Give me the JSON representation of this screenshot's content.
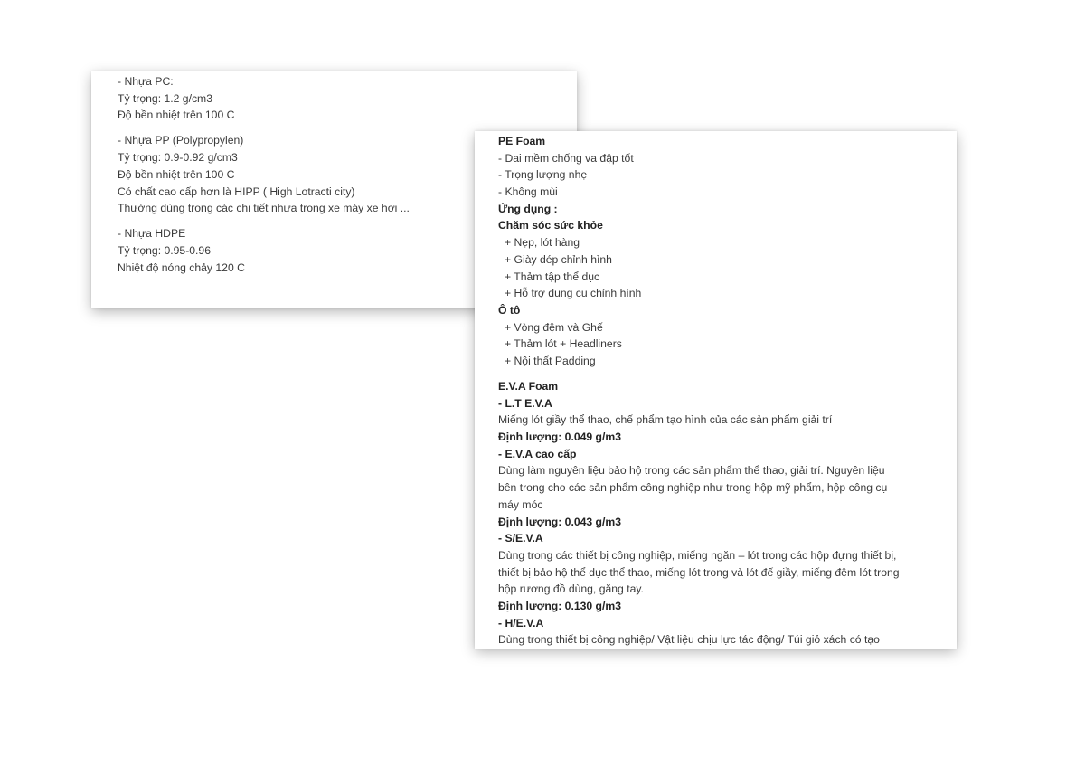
{
  "card_plastics": {
    "pc": {
      "title": "- Nhựa PC:",
      "lines": [
        "Tỷ trọng: 1.2 g/cm3",
        "Độ bền nhiệt trên 100 C"
      ]
    },
    "pp": {
      "title": "- Nhựa PP (Polypropylen)",
      "lines": [
        "Tỷ trọng: 0.9-0.92 g/cm3",
        "Độ bền nhiệt trên 100 C",
        "Có chất cao cấp hơn là HIPP ( High Lotracti city)",
        "Thường dùng trong các chi tiết nhựa trong xe máy xe hơi ..."
      ]
    },
    "hdpe": {
      "title": "- Nhựa HDPE",
      "lines": [
        "Tỷ trọng: 0.95-0.96",
        "Nhiệt độ nóng chảy 120 C"
      ]
    }
  },
  "card_foam": {
    "pe": {
      "title": "PE Foam",
      "features": [
        "- Dai mềm chống va đập tốt",
        "- Trọng lượng nhẹ",
        "- Không mùi"
      ],
      "applications_label": "Ứng dụng :",
      "health_label": "Chăm sóc sức khỏe",
      "health_items": [
        "+ Nẹp, lót hàng",
        "+ Giày dép chỉnh hình",
        "+ Thảm tập thể dục",
        "+ Hỗ trợ dụng cụ chỉnh hình"
      ],
      "auto_label": "Ô tô",
      "auto_items": [
        "+ Vòng đệm và Ghế",
        "+ Thảm lót + Headliners",
        "+ Nội thất Padding"
      ]
    },
    "eva": {
      "title": "E.V.A Foam",
      "lt": {
        "title": "- L.T E.V.A",
        "desc": [
          "Miếng lót giầy thể thao, chế phẩm tạo hình của các sản phẩm giải trí"
        ],
        "weight": "Định lượng: 0.049 g/m3"
      },
      "premium": {
        "title": "- E.V.A cao cấp",
        "desc": [
          "Dùng làm nguyên liệu bảo hộ trong các sản phẩm thể thao, giải trí. Nguyên liệu",
          "bên trong cho các sản phẩm công nghiệp như trong hộp mỹ phẩm, hộp công cụ",
          "máy móc"
        ],
        "weight": "Định lượng: 0.043 g/m3"
      },
      "s": {
        "title": "- S/E.V.A",
        "desc": [
          "Dùng trong các thiết bị công nghiệp, miếng ngăn – lót trong các hộp đựng thiết bị,",
          "thiết bị bảo hộ thể dục thể thao, miếng lót trong và lót đế giầy, miếng đệm lót trong",
          "hộp rương đồ dùng, găng tay."
        ],
        "weight": "Định lượng: 0.130 g/m3"
      },
      "h": {
        "title": "- H/E.V.A",
        "desc": [
          "Dùng trong thiết bị công nghiệp/ Vật liệu chịu lực tác động/ Túi giỏ xách có tạo"
        ]
      }
    }
  }
}
